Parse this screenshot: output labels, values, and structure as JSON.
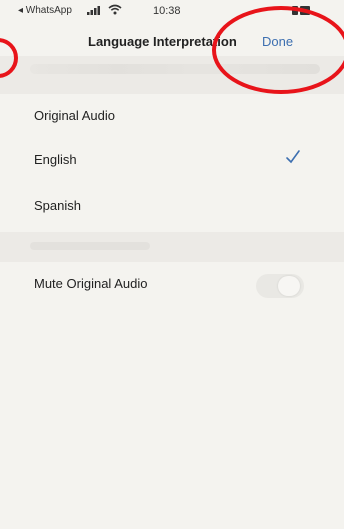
{
  "status_bar": {
    "back_app": "◂ WhatsApp",
    "time": "10:38"
  },
  "nav": {
    "title": "Language Interpretation",
    "done_label": "Done"
  },
  "options": {
    "original": "Original Audio",
    "english": "English",
    "spanish": "Spanish",
    "selected": "English"
  },
  "mute": {
    "label": "Mute Original Audio",
    "enabled": false
  },
  "colors": {
    "accent": "#3d6fb0",
    "annotation": "#e8141a"
  },
  "icons": {
    "check": "checkmark-icon",
    "signal": "signal-icon",
    "wifi": "wifi-icon",
    "battery": "battery-icon"
  }
}
